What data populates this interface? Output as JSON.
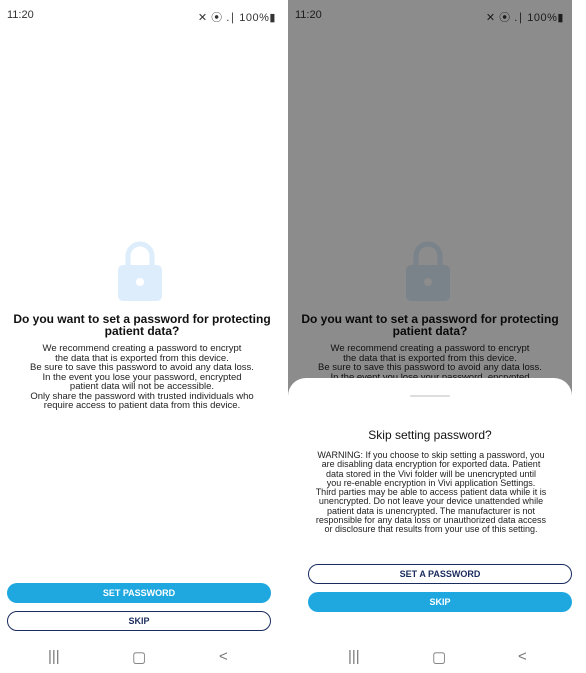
{
  "left": {
    "status": {
      "time": "11:20",
      "icons": "✕ ⦿ .∣ 100%▮"
    },
    "title_lines": [
      "Do you want to set a password for protecting",
      "patient data?"
    ],
    "body_lines": [
      "We recommend creating a password to encrypt",
      "the data that is exported from this device.",
      "Be sure to save this password to avoid any data loss.",
      "In the event you lose your password, encrypted",
      "patient data will not be accessible.",
      "Only share the password with trusted individuals who",
      "require access to patient data from this device."
    ],
    "buttons": {
      "set_password": "SET PASSWORD",
      "skip": "SKIP"
    },
    "nav": {
      "recent": "|||",
      "home": "▢",
      "back": "<"
    }
  },
  "right": {
    "status": {
      "time": "11:20",
      "icons": "✕ ⦿ .∣ 100%▮"
    },
    "title_lines": [
      "Do you want to set a password for protecting",
      "patient data?"
    ],
    "body_lines": [
      "We recommend creating a password to encrypt",
      "the data that is exported from this device.",
      "Be sure to save this password to avoid any data loss.",
      "In the event you lose your password, encrypted"
    ],
    "sheet": {
      "title": "Skip setting password?",
      "warning_lines": [
        "WARNING: If you choose to skip setting a password, you",
        "are disabling data encryption for exported data. Patient",
        "data stored in the Vivi folder will be unencrypted until",
        "you re-enable encryption in Vivi application Settings.",
        "Third parties may be able to access patient data while it is",
        "unencrypted. Do not leave your device unattended while",
        "patient data is unencrypted. The manufacturer is not",
        "responsible for any data loss or unauthorized data access",
        "or disclosure that results from your use of this setting."
      ],
      "buttons": {
        "set_a_password": "SET A PASSWORD",
        "skip": "SKIP"
      }
    },
    "nav": {
      "recent": "|||",
      "home": "▢",
      "back": "<"
    }
  },
  "colors": {
    "accent": "#1fa8e0",
    "outline": "#1a2b5e",
    "lock_left": "#deedfb",
    "lock_right": "#5f6b80"
  }
}
